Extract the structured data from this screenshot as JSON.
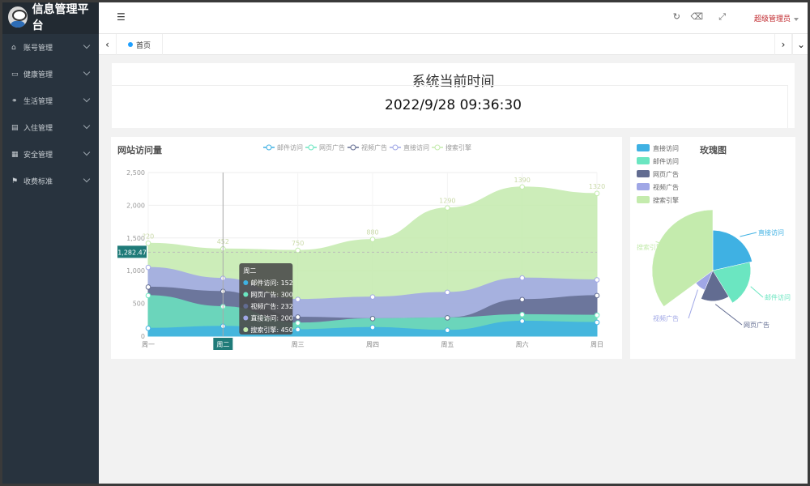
{
  "app": {
    "title": "信息管理平台"
  },
  "sidebar": {
    "items": [
      {
        "label": "账号管理",
        "icon": "home-icon",
        "glyph": "⌂"
      },
      {
        "label": "健康管理",
        "icon": "window-icon",
        "glyph": "▭"
      },
      {
        "label": "生活管理",
        "icon": "share-icon",
        "glyph": "⚭"
      },
      {
        "label": "入住管理",
        "icon": "document-icon",
        "glyph": "▤"
      },
      {
        "label": "安全管理",
        "icon": "calendar-icon",
        "glyph": "▦"
      },
      {
        "label": "收费标准",
        "icon": "flag-icon",
        "glyph": "⚑"
      }
    ]
  },
  "header": {
    "user": "超级管理员"
  },
  "tabs": {
    "home": "首页"
  },
  "time": {
    "title": "系统当前时间",
    "value": "2022/9/28 09:36:30"
  },
  "line_panel": {
    "title": "网站访问量"
  },
  "rose_panel": {
    "title": "玫瑰图"
  },
  "colors": {
    "mail": "#3fb1e3",
    "web": "#6be6c1",
    "video": "#626c91",
    "direct": "#a0a7e6",
    "search": "#c4ebad",
    "sidebar": "#28333e",
    "accent_badge": "#1f7b79"
  },
  "tooltip": {
    "title": "周二",
    "rows": [
      "邮件访问: 152",
      "网页广告: 300",
      "视频广告: 232",
      "直接访问: 200",
      "搜索引擎: 450"
    ]
  },
  "y_pointer": "1,282.47",
  "chart_data": [
    {
      "type": "area",
      "stacked": true,
      "title": "网站访问量",
      "categories": [
        "周一",
        "周二",
        "周三",
        "周四",
        "周五",
        "周六",
        "周日"
      ],
      "ylim": [
        0,
        2500
      ],
      "yticks": [
        0,
        500,
        1000,
        1500,
        2000,
        2500
      ],
      "series": [
        {
          "name": "邮件访问",
          "values": [
            120,
            152,
            101,
            134,
            90,
            230,
            210
          ]
        },
        {
          "name": "网页广告",
          "values": [
            500,
            300,
            100,
            134,
            190,
            100,
            110
          ]
        },
        {
          "name": "视频广告",
          "values": [
            130,
            232,
            90,
            0,
            0,
            230,
            300
          ]
        },
        {
          "name": "直接访问",
          "values": [
            300,
            200,
            270,
            330,
            390,
            330,
            240
          ]
        },
        {
          "name": "搜索引擎",
          "values": [
            370,
            450,
            750,
            880,
            1290,
            1390,
            1320
          ]
        }
      ],
      "top_labels": [
        "?20",
        "452",
        "750",
        "880",
        "1290",
        "1390",
        "1320"
      ],
      "legend": "top"
    },
    {
      "type": "pie",
      "rose": true,
      "title": "玫瑰图",
      "slices": [
        {
          "name": "直接访问",
          "value": 335
        },
        {
          "name": "邮件访问",
          "value": 310
        },
        {
          "name": "网页广告",
          "value": 234
        },
        {
          "name": "视频广告",
          "value": 135
        },
        {
          "name": "搜索引擎",
          "value": 548
        }
      ],
      "legend": "top-left"
    }
  ]
}
